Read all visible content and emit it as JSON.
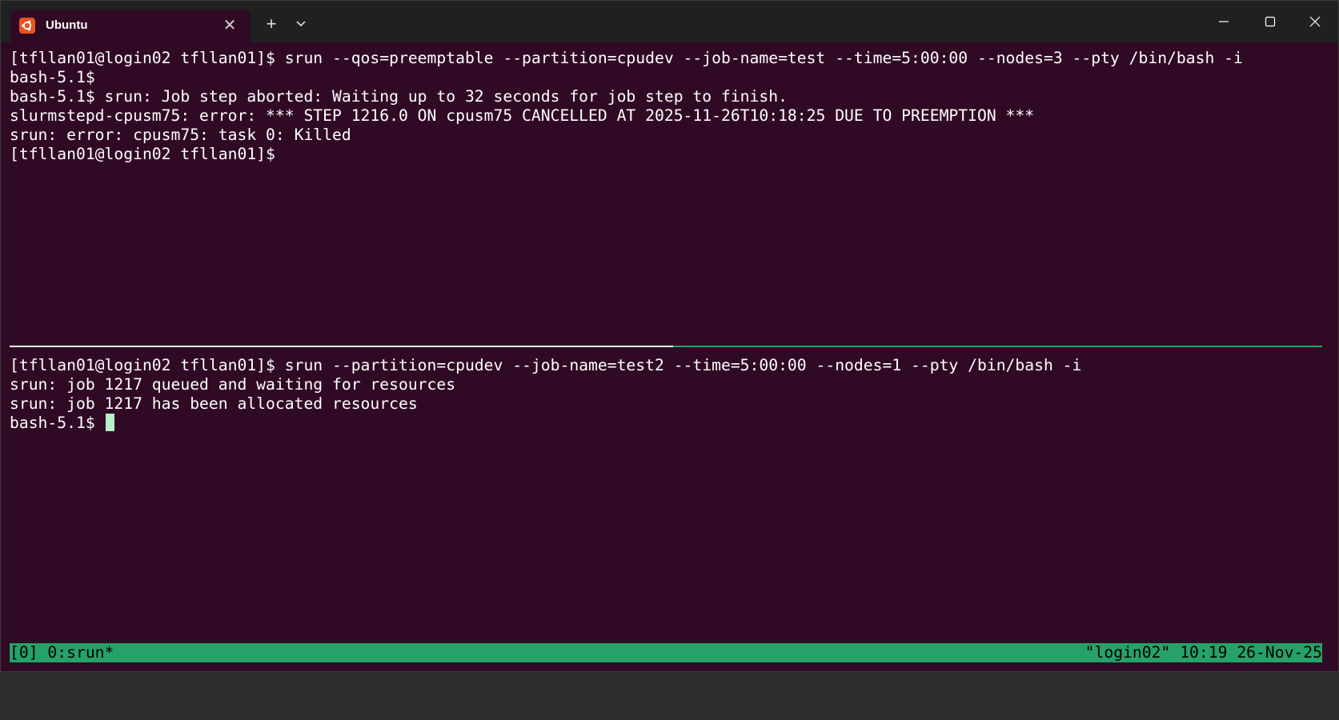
{
  "tab": {
    "title": "Ubuntu",
    "icon": "ubuntu-logo-icon",
    "close_glyph": "✕",
    "new_tab_glyph": "+"
  },
  "colors": {
    "terminal_background": "#300a24",
    "titlebar_background": "#202020",
    "status_bar": "#26a269",
    "cursor": "#b4f0c8",
    "ubuntu_orange": "#e95420"
  },
  "terminal": {
    "top_pane": {
      "lines": [
        "[tfllan01@login02 tfllan01]$ srun --qos=preemptable --partition=cpudev --job-name=test --time=5:00:00 --nodes=3 --pty /bin/bash -i",
        "bash-5.1$",
        "bash-5.1$ srun: Job step aborted: Waiting up to 32 seconds for job step to finish.",
        "slurmstepd-cpusm75: error: *** STEP 1216.0 ON cpusm75 CANCELLED AT 2025-11-26T10:18:25 DUE TO PREEMPTION ***",
        "srun: error: cpusm75: task 0: Killed",
        "[tfllan01@login02 tfllan01]$"
      ]
    },
    "bottom_pane": {
      "lines": [
        "[tfllan01@login02 tfllan01]$ srun --partition=cpudev --job-name=test2 --time=5:00:00 --nodes=1 --pty /bin/bash -i",
        "srun: job 1217 queued and waiting for resources",
        "srun: job 1217 has been allocated resources"
      ],
      "prompt": "bash-5.1$ "
    }
  },
  "status_bar": {
    "left": "[0] 0:srun*",
    "right": "\"login02\" 10:19 26-Nov-25"
  }
}
